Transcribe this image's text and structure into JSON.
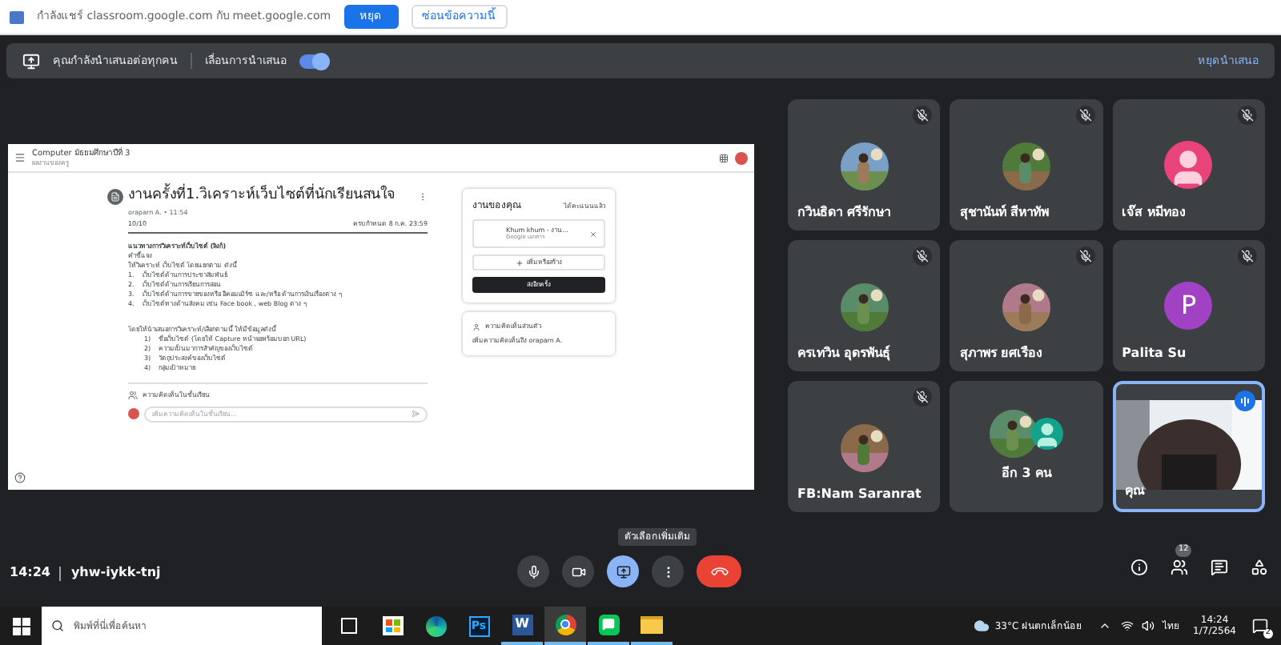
{
  "share_notice": {
    "text": "กำลังแชร์ classroom.google.com กับ meet.google.com",
    "stop_button": "หยุด",
    "hide_button": "ซ่อนข้อความนี้"
  },
  "presenting_bar": {
    "text": "คุณกำลังนำเสนอต่อทุกคน",
    "toggle_label": "เลื่อนการนำเสนอ",
    "toggle_on": true,
    "stop_button": "หยุดนำเสนอ"
  },
  "shared_screen": {
    "class_name": "Computer มัธยมศึกษาปีที่ 3",
    "class_sub": "ผลงานของครู",
    "title": "งานครั้งที่1.วิเคราะห์เว็บไซต์ที่นักเรียนสนใจ",
    "author": "oraparn A. • 11:54",
    "points": "10/10",
    "due": "ครบกำหนด 8 ก.ค. 23:59",
    "body": [
      "แนวทางการวิเคราะห์เว็บไซต์ (ลิงก์)",
      "คำชี้แจง",
      "ให้วิเคราะห์ เว็บไซต์ โดยแยกตาม ดังนี้",
      "1.    เว็บไซต์ด้านการประชาสัมพันธ์",
      "2.    เว็บไซต์ด้านการเรียนการสอน",
      "3.    เว็บไซต์ด้านการขายของหรือ อีคอมเมิร์ซ และ/หรือ ด้านการเงินเรื่องต่าง ๆ",
      "4.    เว็บไซต์ทางด้านสังคม เช่น Face book , web Blog ต่าง ๆ"
    ],
    "body2": [
      "โดยให้นำเสนอการวิเคราะห์/เลือกตามนี้ ให้มีข้อมูลดังนี้",
      "1)    ชื่อเว็บไซต์ (โดยให้ Capture หน้าจอพร้อมบอก URL)",
      "2)    ความเป็นมาการสำคัญของเว็บไซต์",
      "3)    วัตถุประสงค์ของเว็บไซต์",
      "4)    กลุ่มเป้าหมาย"
    ],
    "class_comments": "ความคิดเห็นในชั้นเรียน",
    "comment_placeholder": "เพิ่มความคิดเห็นในชั้นเรียน...",
    "work_title": "งานของคุณ",
    "work_status": "ได้คะแนนแล้ว",
    "attachment_name": "Khum khum - งาน...",
    "attachment_type": "Google เอกสาร",
    "add_button": "เพิ่มหรือสร้าง",
    "resubmit_button": "ส่งอีกครั้ง",
    "private_title": "ความคิดเห็นส่วนตัว",
    "private_placeholder": "เพิ่มความคิดเห็นถึง oraparn A."
  },
  "participants": [
    {
      "name": "กวินธิดา ศรีรักษา",
      "muted": true
    },
    {
      "name": "สุชานันท์ สีหาทัพ",
      "muted": true
    },
    {
      "kind": "icon",
      "name": "เจ๊ส หมีทอง",
      "muted": true,
      "color": "#e8437a"
    },
    {
      "name": "ครเทวิน อุดรพันธุ์",
      "muted": true
    },
    {
      "name": "สุภาพร ยศเรือง",
      "muted": true
    },
    {
      "kind": "initial",
      "initial": "P",
      "name": "Palita Su",
      "muted": true,
      "color": "#a142c4"
    },
    {
      "name": "FB:Nam Saranrat",
      "muted": true
    },
    {
      "kind": "more",
      "name": "อีก 3 คน",
      "muted": false
    },
    {
      "kind": "video",
      "name": "คุณ",
      "muted": false,
      "speaking": true
    }
  ],
  "meeting": {
    "time": "14:24",
    "code": "yhw-iykk-tnj",
    "tooltip": "ตัวเลือกเพิ่มเติม",
    "people_count": "12"
  },
  "taskbar": {
    "search_placeholder": "พิมพ์ที่นี่เพื่อค้นหา",
    "apps": [
      {
        "kind": "taskview",
        "active": false
      },
      {
        "kind": "store",
        "active": false
      },
      {
        "kind": "edge",
        "active": false
      },
      {
        "kind": "ps",
        "label": "Ps",
        "active": false
      },
      {
        "kind": "word",
        "label": "W",
        "active": true
      },
      {
        "kind": "chrome",
        "active": true
      },
      {
        "kind": "line",
        "active": true
      },
      {
        "kind": "folder",
        "active": true
      }
    ],
    "weather": "33°C ฝนตกเล็กน้อย",
    "language": "ไทย",
    "time": "14:24",
    "date": "1/7/2564",
    "notifications": "2"
  }
}
